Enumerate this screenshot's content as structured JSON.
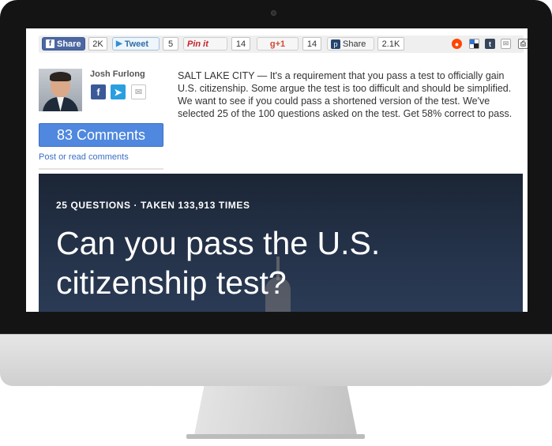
{
  "share_bar": {
    "facebook": {
      "label": "Share",
      "count": "2K",
      "icon": "facebook-icon"
    },
    "twitter": {
      "label": "Tweet",
      "count": "5",
      "icon": "twitter-bird-icon"
    },
    "pinterest": {
      "label": "Pin it",
      "count": "14"
    },
    "google_plus": {
      "label": "g+1",
      "count": "14"
    },
    "pocket": {
      "label": "Share",
      "count": "2.1K",
      "icon": "p-icon"
    },
    "extra_icons": [
      "reddit-icon",
      "delicious-icon",
      "tumblr-icon",
      "email-icon",
      "print-icon"
    ],
    "tumblr_glyph": "t"
  },
  "author": {
    "name": "Josh Furlong",
    "social_icons": [
      "facebook-icon",
      "twitter-icon",
      "email-icon"
    ]
  },
  "comments": {
    "button_label": "83 Comments",
    "link_label": "Post or read comments"
  },
  "article": {
    "intro": "SALT LAKE CITY — It's a requirement that you pass a test to officially gain U.S. citizenship. Some argue the test is too difficult and should be simplified. We want to see if you could pass a shortened version of the test. We've selected 25 of the 100 questions asked on the test. Get 58% correct to pass."
  },
  "quiz": {
    "meta": "25 QUESTIONS · TAKEN 133,913 TIMES",
    "title": "Can you pass the U.S. citizenship test?"
  },
  "colors": {
    "bezel": "#141414",
    "facebook": "#3b5998",
    "twitter": "#2a9fe0",
    "comments_button": "#4f88de",
    "banner": "#243249"
  }
}
